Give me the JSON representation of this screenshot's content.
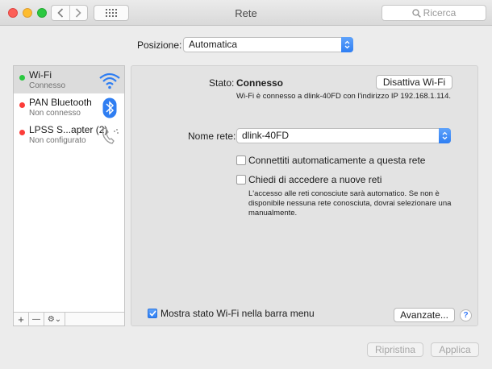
{
  "window": {
    "title": "Rete"
  },
  "search": {
    "placeholder": "Ricerca"
  },
  "location": {
    "label": "Posizione:",
    "value": "Automatica"
  },
  "services": [
    {
      "name": "Wi-Fi",
      "status": "Connesso",
      "status_color": "#2bc840",
      "icon": "wifi-icon"
    },
    {
      "name": "PAN Bluetooth",
      "status": "Non connesso",
      "status_color": "#fc3d39",
      "icon": "bluetooth-icon"
    },
    {
      "name": "LPSS S...apter (2)",
      "status": "Non configurato",
      "status_color": "#fc3d39",
      "icon": "phone-icon"
    }
  ],
  "sidebar_tools": {
    "add": "+",
    "remove": "—",
    "gear": "⚙︎⌄"
  },
  "detail": {
    "status_label": "Stato:",
    "status_value": "Connesso",
    "toggle_button": "Disattiva Wi-Fi",
    "status_desc": "Wi-Fi è connesso a dlink-40FD con l'indirizzo IP 192.168.1.114.",
    "network_label": "Nome rete:",
    "network_value": "dlink-40FD",
    "auto_join_label": "Connettiti automaticamente a questa rete",
    "ask_join_label": "Chiedi di accedere a nuove reti",
    "ask_join_desc_1": "L'accesso alle reti conosciute sarà automatico. Se non è",
    "ask_join_desc_2": "disponibile nessuna rete conosciuta, dovrai selezionare una",
    "ask_join_desc_3": "manualmente.",
    "show_menu_label": "Mostra stato Wi-Fi nella barra menu",
    "advanced_button": "Avanzate...",
    "help": "?"
  },
  "footer": {
    "revert": "Ripristina",
    "apply": "Applica"
  },
  "colors": {
    "accent": "#3478f6",
    "close": "#fc5f57",
    "minimize": "#fdbc2e",
    "maximize": "#2bc840"
  }
}
